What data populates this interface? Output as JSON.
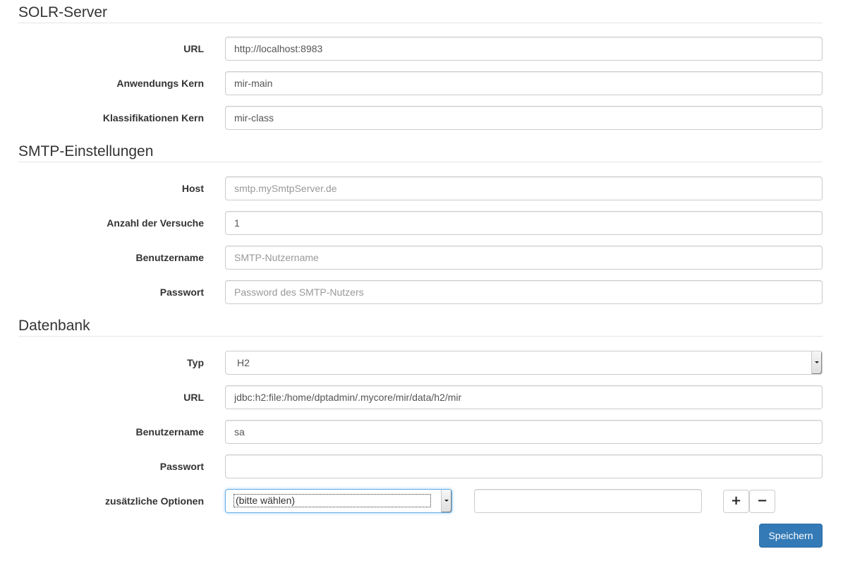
{
  "solr": {
    "title": "SOLR-Server",
    "url_label": "URL",
    "url_value": "http://localhost:8983",
    "core_label": "Anwendungs Kern",
    "core_value": "mir-main",
    "class_label": "Klassifikationen Kern",
    "class_value": "mir-class"
  },
  "smtp": {
    "title": "SMTP-Einstellungen",
    "host_label": "Host",
    "host_placeholder": "smtp.mySmtpServer.de",
    "tries_label": "Anzahl der Versuche",
    "tries_value": "1",
    "user_label": "Benutzername",
    "user_placeholder": "SMTP-Nutzername",
    "pass_label": "Passwort",
    "pass_placeholder": "Password des SMTP-Nutzers"
  },
  "db": {
    "title": "Datenbank",
    "type_label": "Typ",
    "type_value": "H2",
    "url_label": "URL",
    "url_value": "jdbc:h2:file:/home/dptadmin/.mycore/mir/data/h2/mir",
    "user_label": "Benutzername",
    "user_value": "sa",
    "pass_label": "Passwort",
    "pass_value": "",
    "options_label": "zusätzliche Optionen",
    "options_selected": "(bitte wählen)",
    "option_value": "",
    "add_symbol": "+",
    "remove_symbol": "−"
  },
  "actions": {
    "save_label": "Speichern"
  }
}
